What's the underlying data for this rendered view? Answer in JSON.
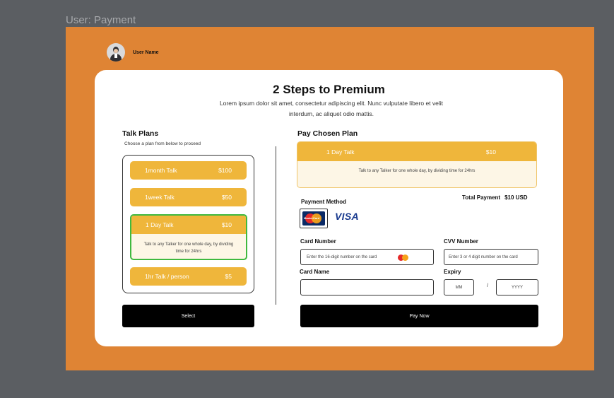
{
  "frame": {
    "label": "User: Payment"
  },
  "user": {
    "name": "User Name"
  },
  "header": {
    "title": "2 Steps to Premium",
    "subtitle": "Lorem ipsum dolor sit amet, consectetur adipiscing elit. Nunc vulputate libero et velit interdum, ac aliquet odio mattis."
  },
  "plans": {
    "title": "Talk Plans",
    "hint": "Choose a plan from  below to proceed",
    "items": [
      {
        "name": "1month Talk",
        "price": "$100"
      },
      {
        "name": "1week Talk",
        "price": "$50"
      },
      {
        "name": "1 Day Talk",
        "price": "$10",
        "description": "Talk to any Talker for one whole day, by dividing  time for 24hrs"
      },
      {
        "name": "1hr Talk / person",
        "price": "$5"
      }
    ],
    "select_label": "Select"
  },
  "payment": {
    "title": "Pay Chosen Plan",
    "chosen": {
      "name": "1 Day Talk",
      "price": "$10",
      "description": "Talk to any Talker for one whole day, by dividing  time for 24hrs"
    },
    "total_label": "Total Payment",
    "total_value": "$10 USD",
    "method_label": "Payment Method",
    "mastercard_text": "MasterCard",
    "visa_text": "VISA",
    "card_number": {
      "label": "Card Number",
      "placeholder": "Enter the 16-digit number on the card"
    },
    "cvv": {
      "label": "CVV Number",
      "placeholder": "Enter 3 or 4 digit number on the card"
    },
    "card_name": {
      "label": "Card Name",
      "value": ""
    },
    "expiry": {
      "label": "Expiry",
      "month_placeholder": "MM",
      "separator": "/",
      "year_placeholder": "YYYY"
    },
    "pay_label": "Pay Now"
  }
}
